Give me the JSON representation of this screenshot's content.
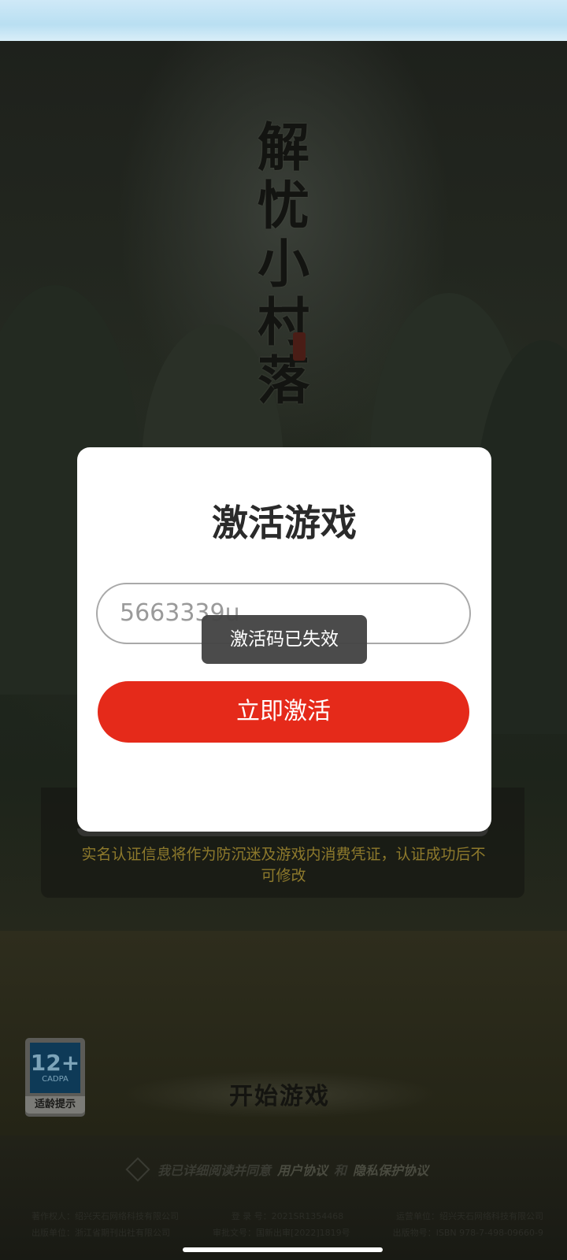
{
  "logo": {
    "chars": [
      "解",
      "忧",
      "小",
      "村",
      "落"
    ]
  },
  "modal": {
    "title": "激活游戏",
    "input_value": "5663339u",
    "activate_label": "立即激活"
  },
  "toast": {
    "message": "激活码已失效"
  },
  "notice": {
    "text": "实名认证信息将作为防沉迷及游戏内消费凭证，认证成功后不可修改"
  },
  "age_rating": {
    "age": "12+",
    "org": "CADPA",
    "label": "适龄提示"
  },
  "start_game": {
    "label": "开始游戏"
  },
  "agreement": {
    "prefix": "我已详细阅读并同意",
    "user_agreement": "用户协议",
    "and": "和",
    "privacy_agreement": "隐私保护协议"
  },
  "footer": {
    "copyright_holder": "著作权人：绍兴天石网络科技有限公司",
    "registration": "登 录 号：2021SR1354468",
    "operator": "运营单位：绍兴天石网络科技有限公司",
    "publisher": "出版单位：浙江省期刊出社有限公司",
    "approval": "审批文号：国新出审[2022]1819号",
    "isbn": "出版物号：ISBN 978-7-498-09660-9"
  }
}
